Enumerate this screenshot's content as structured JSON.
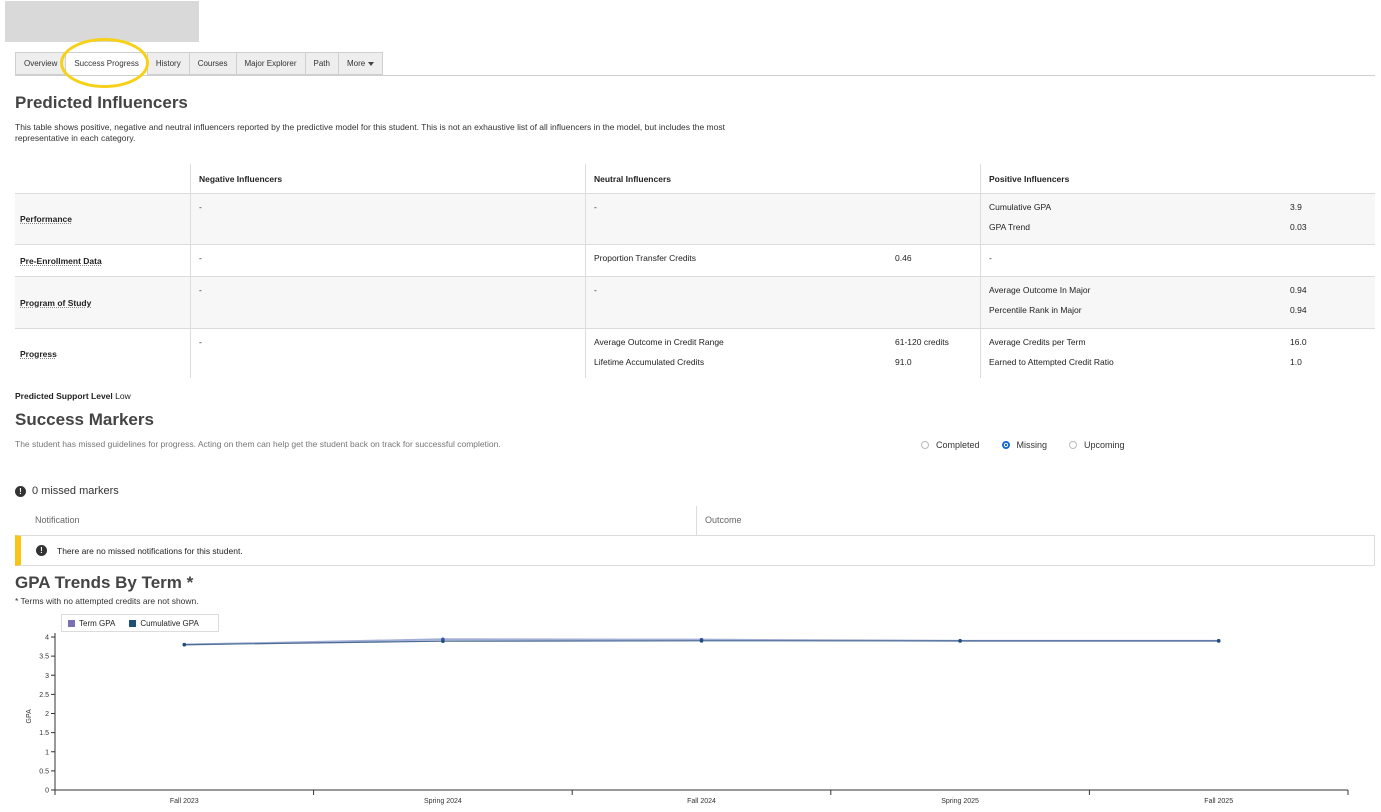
{
  "tabs": [
    {
      "label": "Overview",
      "active": false
    },
    {
      "label": "Success Progress",
      "active": true
    },
    {
      "label": "History",
      "active": false
    },
    {
      "label": "Courses",
      "active": false
    },
    {
      "label": "Major Explorer",
      "active": false
    },
    {
      "label": "Path",
      "active": false
    },
    {
      "label": "More",
      "active": false
    }
  ],
  "predicted": {
    "title": "Predicted Influencers",
    "description": "This table shows positive, negative and neutral influencers reported by the predictive model for this student. This is not an exhaustive list of all influencers in the model, but includes the most representative in each category.",
    "columns": [
      "Negative Influencers",
      "Neutral Influencers",
      "Positive Influencers"
    ],
    "rows": [
      {
        "category": "Performance",
        "negative": [
          "-"
        ],
        "neutral": [
          "-"
        ],
        "positive": [
          {
            "label": "Cumulative GPA",
            "value": "3.9"
          },
          {
            "label": "GPA Trend",
            "value": "0.03"
          }
        ]
      },
      {
        "category": "Pre-Enrollment Data",
        "negative": [
          "-"
        ],
        "neutral": [
          {
            "label": "Proportion Transfer Credits",
            "value": "0.46"
          }
        ],
        "positive": [
          "-"
        ]
      },
      {
        "category": "Program of Study",
        "negative": [
          "-"
        ],
        "neutral": [
          "-"
        ],
        "positive": [
          {
            "label": "Average Outcome In Major",
            "value": "0.94"
          },
          {
            "label": "Percentile Rank in Major",
            "value": "0.94"
          }
        ]
      },
      {
        "category": "Progress",
        "negative": [
          "-"
        ],
        "neutral": [
          {
            "label": "Average Outcome in Credit Range",
            "value": "61-120 credits"
          },
          {
            "label": "Lifetime Accumulated Credits",
            "value": "91.0"
          }
        ],
        "positive": [
          {
            "label": "Average Credits per Term",
            "value": "16.0"
          },
          {
            "label": "Earned to Attempted Credit Ratio",
            "value": "1.0"
          }
        ]
      }
    ],
    "support_label": "Predicted Support Level",
    "support_value": "Low"
  },
  "markers": {
    "title": "Success Markers",
    "description": "The student has missed guidelines for progress. Acting on them can help get the student back on track for successful completion.",
    "filters": [
      {
        "label": "Completed",
        "selected": false
      },
      {
        "label": "Missing",
        "selected": true
      },
      {
        "label": "Upcoming",
        "selected": false
      }
    ],
    "missed_count_text": "0 missed markers",
    "columns": [
      "Notification",
      "Outcome"
    ],
    "empty_message": "There are no missed notifications for this student."
  },
  "gpa": {
    "title": "GPA Trends By Term *",
    "footnote": "* Terms with no attempted credits are not shown.",
    "legend": [
      {
        "name": "Term GPA",
        "color": "#7b6fb5"
      },
      {
        "name": "Cumulative GPA",
        "color": "#1f4e79"
      }
    ]
  },
  "chart_data": {
    "type": "line",
    "categories": [
      "Fall 2023",
      "Spring 2024",
      "Fall 2024",
      "Spring 2025",
      "Fall 2025"
    ],
    "series": [
      {
        "name": "Term GPA",
        "values": [
          3.8,
          3.94,
          3.93,
          3.9,
          3.9
        ]
      },
      {
        "name": "Cumulative GPA",
        "values": [
          3.8,
          3.89,
          3.9,
          3.9,
          3.9
        ]
      }
    ],
    "ylabel": "GPA",
    "ylim": [
      0,
      4
    ],
    "yticks": [
      "0",
      "0.5",
      "1",
      "1.5",
      "2",
      "2.5",
      "3",
      "3.5",
      "4"
    ],
    "legend": "top-left"
  }
}
